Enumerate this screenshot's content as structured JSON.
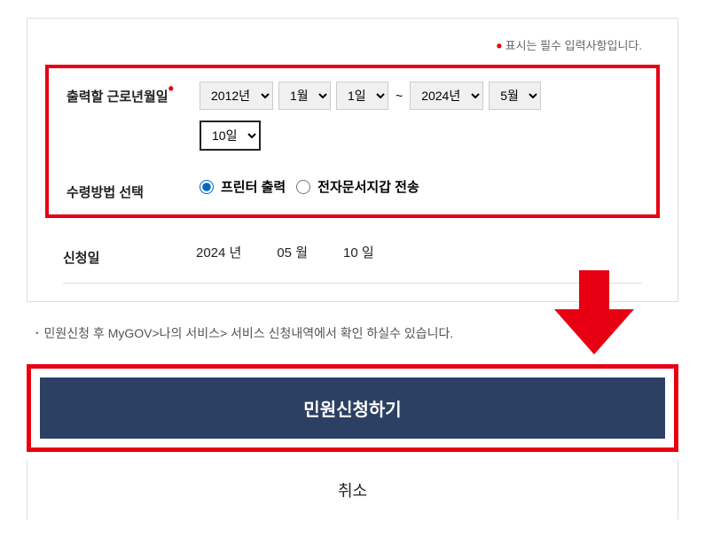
{
  "required_text": "표시는 필수 입력사항입니다.",
  "form": {
    "date_range": {
      "label": "출력할 근로년월일",
      "start_year": "2012년",
      "start_month": "1월",
      "start_day": "1일",
      "tilde": "~",
      "end_year": "2024년",
      "end_month": "5월",
      "end_day": "10일"
    },
    "receive_method": {
      "label": "수령방법 선택",
      "option1": "프린터 출력",
      "option2": "전자문서지갑 전송"
    },
    "apply_date": {
      "label": "신청일",
      "year": "2024 년",
      "month": "05 월",
      "day": "10 일"
    }
  },
  "info_text": "민원신청 후 MyGOV>나의 서비스> 서비스 신청내역에서 확인 하실수 있습니다.",
  "submit_label": "민원신청하기",
  "cancel_label": "취소"
}
